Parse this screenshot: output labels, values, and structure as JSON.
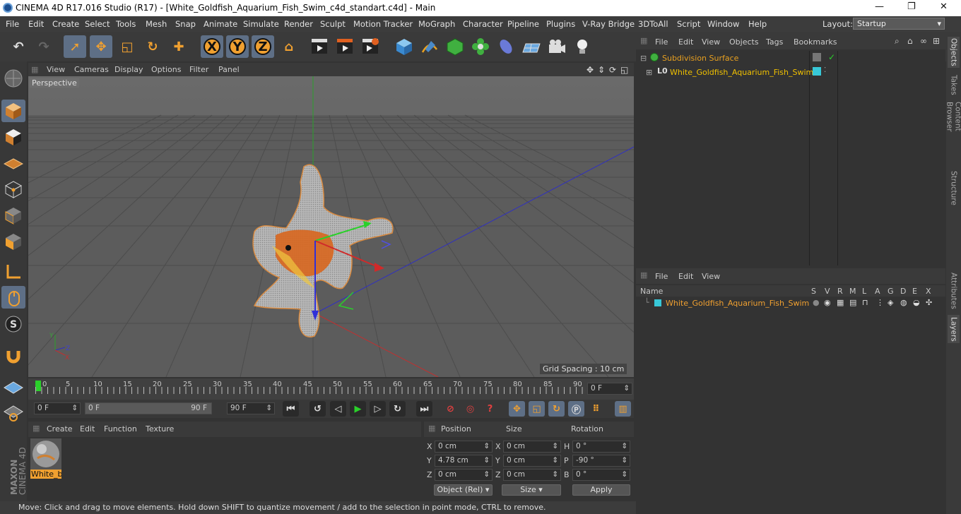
{
  "window": {
    "title": "CINEMA 4D R17.016 Studio (R17) - [White_Goldfish_Aquarium_Fish_Swim_c4d_standart.c4d] - Main",
    "min": "—",
    "max": "❐",
    "close": "✕"
  },
  "menubar": {
    "items": [
      "File",
      "Edit",
      "Create",
      "Select",
      "Tools",
      "Mesh",
      "Snap",
      "Animate",
      "Simulate",
      "Render",
      "Sculpt",
      "Motion Tracker",
      "MoGraph",
      "Character",
      "Pipeline",
      "Plugins",
      "V-Ray Bridge",
      "3DToAll",
      "Script",
      "Window",
      "Help"
    ],
    "layout_label": "Layout:",
    "layout_value": "Startup"
  },
  "toolbar": {
    "undo": "↶",
    "redo": "↷",
    "select": "➚",
    "move": "✥",
    "scale": "◱",
    "rotate": "↻",
    "add": "✚",
    "x": "X",
    "y": "Y",
    "z": "Z",
    "world": "⌂"
  },
  "viewport": {
    "menu": [
      "View",
      "Cameras",
      "Display",
      "Options",
      "Filter",
      "Panel"
    ],
    "label": "Perspective",
    "grid_spacing": "Grid Spacing : 10 cm"
  },
  "timeline": {
    "ticks": [
      "0",
      "5",
      "10",
      "15",
      "20",
      "25",
      "30",
      "35",
      "40",
      "45",
      "50",
      "55",
      "60",
      "65",
      "70",
      "75",
      "80",
      "85",
      "90"
    ],
    "current_frame": "0 F",
    "start": "0 F",
    "range_start": "0 F",
    "range_end": "90 F",
    "end": "90 F"
  },
  "material_panel": {
    "menu": [
      "Create",
      "Edit",
      "Function",
      "Texture"
    ],
    "material_name": "White_b"
  },
  "coord_panel": {
    "headers": [
      "Position",
      "Size",
      "Rotation"
    ],
    "rows": [
      {
        "axis": "X",
        "pos": "0 cm",
        "saxis": "X",
        "size": "0 cm",
        "raxis": "H",
        "rot": "0 °"
      },
      {
        "axis": "Y",
        "pos": "4.78 cm",
        "saxis": "Y",
        "size": "0 cm",
        "raxis": "P",
        "rot": "-90 °"
      },
      {
        "axis": "Z",
        "pos": "0 cm",
        "saxis": "Z",
        "size": "0 cm",
        "raxis": "B",
        "rot": "0 °"
      }
    ],
    "mode": "Object (Rel)",
    "size_mode": "Size",
    "apply": "Apply"
  },
  "object_panel": {
    "menu": [
      "File",
      "Edit",
      "View",
      "Objects",
      "Tags",
      "Bookmarks"
    ],
    "items": [
      {
        "name": "Subdivision Surface",
        "color": "#e8a020"
      },
      {
        "name": "White_Goldfish_Aquarium_Fish_Swim",
        "color": "#f0c000"
      }
    ]
  },
  "layer_panel": {
    "menu": [
      "File",
      "Edit",
      "View"
    ],
    "columns": [
      "Name",
      "S",
      "V",
      "R",
      "M",
      "L",
      "A",
      "G",
      "D",
      "E",
      "X"
    ],
    "row_name": "White_Goldfish_Aquarium_Fish_Swim"
  },
  "right_tabs": [
    "Objects",
    "Takes",
    "Content Browser",
    "Structure",
    "Attributes",
    "Layers"
  ],
  "brand": {
    "maxon": "MAXON",
    "product": "CINEMA 4D"
  },
  "status": "Move: Click and drag to move elements. Hold down SHIFT to quantize movement / add to the selection in point mode, CTRL to remove.",
  "colors": {
    "accent": "#f0a030",
    "selection": "#5e6f86",
    "layer_cyan": "#38c8d8"
  }
}
